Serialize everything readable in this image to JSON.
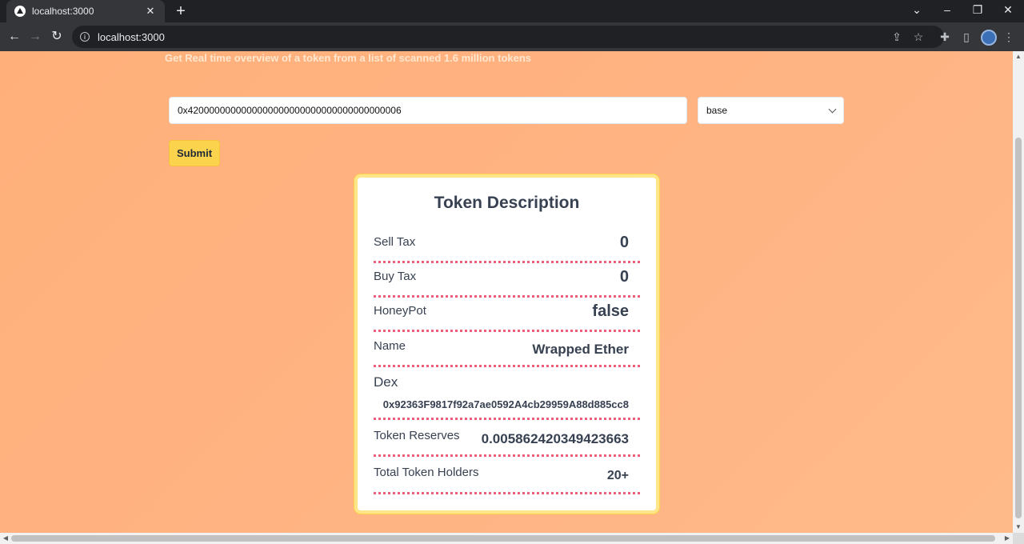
{
  "browser": {
    "tab_title": "localhost:3000",
    "url": "localhost:3000"
  },
  "page": {
    "subtitle": "Get Real time overview of a token from a list of scanned 1.6 million tokens",
    "token_address_value": "0x4200000000000000000000000000000000000006",
    "chain_selected": "base",
    "submit_label": "Submit"
  },
  "card": {
    "title": "Token Description",
    "rows": [
      {
        "label": "Sell Tax",
        "value": "0"
      },
      {
        "label": "Buy Tax",
        "value": "0"
      },
      {
        "label": "HoneyPot",
        "value": "false"
      },
      {
        "label": "Name",
        "value": "Wrapped Ether"
      },
      {
        "label": "Dex",
        "value": "0x92363F9817f92a7ae0592A4cb29959A88d885cc8"
      },
      {
        "label": "Token Reserves",
        "value": "0.005862420349423663"
      },
      {
        "label": "Total Token Holders",
        "value": "20+"
      }
    ]
  }
}
